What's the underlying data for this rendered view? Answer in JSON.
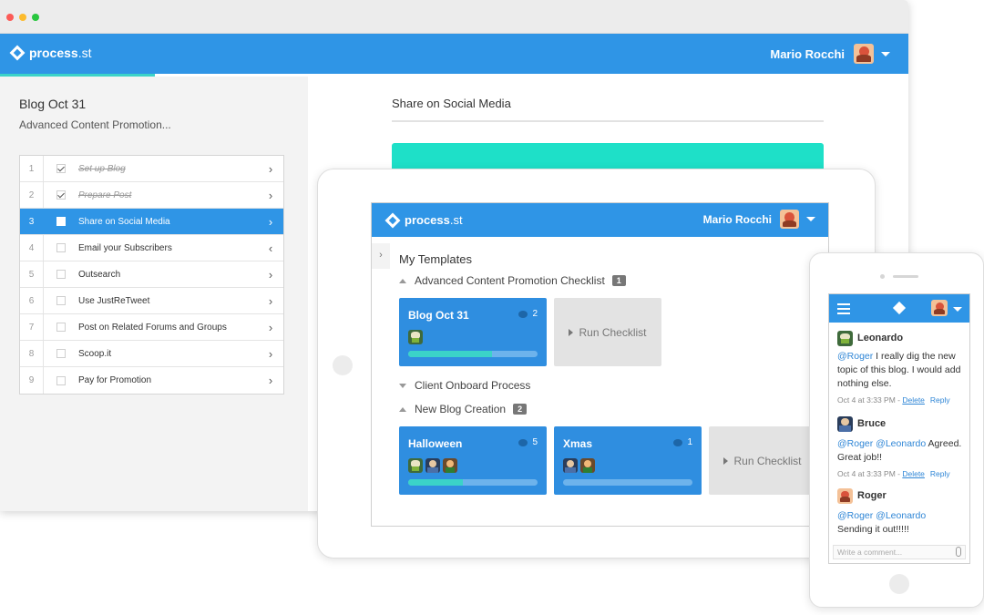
{
  "brand": {
    "name": "process",
    "suffix": ".st",
    "blue": "#2f95e6",
    "teal": "#1ee0c8"
  },
  "user": {
    "name": "Mario Rocchi"
  },
  "desktop": {
    "checklist_title": "Blog Oct 31",
    "checklist_subtitle": "Advanced Content Promotion...",
    "tasks": [
      {
        "num": "1",
        "label": "Set up Blog",
        "done": true,
        "active": false,
        "arrow": "›"
      },
      {
        "num": "2",
        "label": "Prepare Post",
        "done": true,
        "active": false,
        "arrow": "›"
      },
      {
        "num": "3",
        "label": "Share on Social Media",
        "done": false,
        "active": true,
        "arrow": "›"
      },
      {
        "num": "4",
        "label": "Email your Subscribers",
        "done": false,
        "active": false,
        "arrow": "‹"
      },
      {
        "num": "5",
        "label": "Outsearch",
        "done": false,
        "active": false,
        "arrow": "›"
      },
      {
        "num": "6",
        "label": "Use JustReTweet",
        "done": false,
        "active": false,
        "arrow": "›"
      },
      {
        "num": "7",
        "label": "Post on Related Forums and Groups",
        "done": false,
        "active": false,
        "arrow": "›"
      },
      {
        "num": "8",
        "label": "Scoop.it",
        "done": false,
        "active": false,
        "arrow": "›"
      },
      {
        "num": "9",
        "label": "Pay for Promotion",
        "done": false,
        "active": false,
        "arrow": "›"
      }
    ],
    "task_title": "Share on Social Media"
  },
  "tablet": {
    "heading": "My Templates",
    "groups": [
      {
        "name": "Advanced Content Promotion Checklist",
        "count": "1"
      },
      {
        "name": "Client Onboard Process",
        "count": ""
      },
      {
        "name": "New Blog Creation",
        "count": "2"
      }
    ],
    "cards": [
      {
        "title": "Blog Oct 31",
        "comments": "2",
        "progress": 0.65
      },
      {
        "title": "Halloween",
        "comments": "5",
        "progress": 0.42
      },
      {
        "title": "Xmas",
        "comments": "1",
        "progress": 0.0
      }
    ],
    "run_label": "Run Checklist"
  },
  "phone": {
    "comments": [
      {
        "author": "Leonardo",
        "mention": "@Roger",
        "text": " I really dig the new topic of this blog. I would add nothing else.",
        "time": "Oct 4 at 3:33 PM - ",
        "delete": "Delete",
        "reply": "Reply"
      },
      {
        "author": "Bruce",
        "mention": "@Roger @Leonardo",
        "text": " Agreed. Great job!!",
        "time": "Oct 4 at 3:33 PM - ",
        "delete": "Delete",
        "reply": "Reply"
      },
      {
        "author": "Roger",
        "mention": "@Roger @Leonardo",
        "text": " Sending it out!!!!!"
      }
    ],
    "input_placeholder": "Write a comment..."
  }
}
